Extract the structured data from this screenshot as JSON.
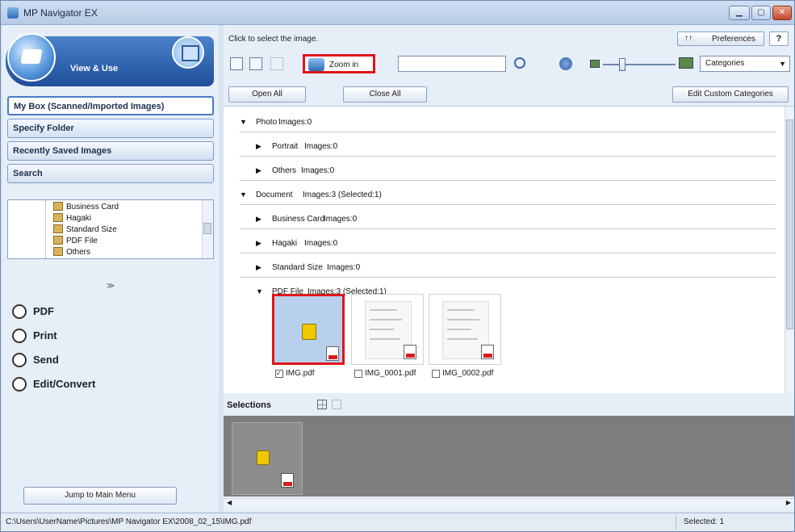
{
  "window": {
    "title": "MP Navigator EX",
    "controls": [
      "minimize",
      "maximize",
      "close"
    ]
  },
  "left": {
    "view_use_label": "View & Use",
    "nav": [
      {
        "label": "My Box (Scanned/Imported Images)",
        "active": true
      },
      {
        "label": "Specify Folder",
        "active": false
      },
      {
        "label": "Recently Saved Images",
        "active": false
      },
      {
        "label": "Search",
        "active": false
      }
    ],
    "tree": [
      "Business Card",
      "Hagaki",
      "Standard Size",
      "PDF File",
      "Others"
    ],
    "collapse_glyph": "≫",
    "actions": [
      "PDF",
      "Print",
      "Send",
      "Edit/Convert"
    ],
    "jump_label": "Jump to Main Menu"
  },
  "right": {
    "hint": "Click to select the image.",
    "preferences_label": "Preferences",
    "preferences_icon": "↑↑",
    "help_label": "?",
    "zoom_label": "Zoom in",
    "search_value": "",
    "category_value": "Categories",
    "open_all": "Open All",
    "close_all": "Close All",
    "edit_categories": "Edit Custom Categories",
    "rows": [
      {
        "label": "Photo",
        "count": "Images:0",
        "expanded": true
      },
      {
        "label": "Portrait",
        "count": "Images:0",
        "expanded": false
      },
      {
        "label": "Others",
        "count": "Images:0",
        "expanded": false
      },
      {
        "label": "Document",
        "count": "Images:3  (Selected:1)",
        "expanded": true
      },
      {
        "label": "Business Card",
        "count": "Images:0",
        "expanded": false
      },
      {
        "label": "Hagaki",
        "count": "Images:0",
        "expanded": false
      },
      {
        "label": "Standard Size",
        "count": "Images:0",
        "expanded": false
      },
      {
        "label": "PDF File",
        "count": "Images:3  (Selected:1)",
        "expanded": true
      }
    ],
    "thumbs": [
      {
        "name": "IMG.pdf",
        "checked": true,
        "locked": true
      },
      {
        "name": "IMG_0001.pdf",
        "checked": false,
        "locked": false
      },
      {
        "name": "IMG_0002.pdf",
        "checked": false,
        "locked": false
      }
    ],
    "selections_label": "Selections"
  },
  "status": {
    "path": "C:\\Users\\UserName\\Pictures\\MP Navigator EX\\2008_02_15\\IMG.pdf",
    "selected": "Selected: 1"
  },
  "colors": {
    "highlight": "#e0151a",
    "window_bg": "#d9e4f1",
    "pane_bg": "#e6eef8",
    "selection_area": "#7d7d7d"
  }
}
